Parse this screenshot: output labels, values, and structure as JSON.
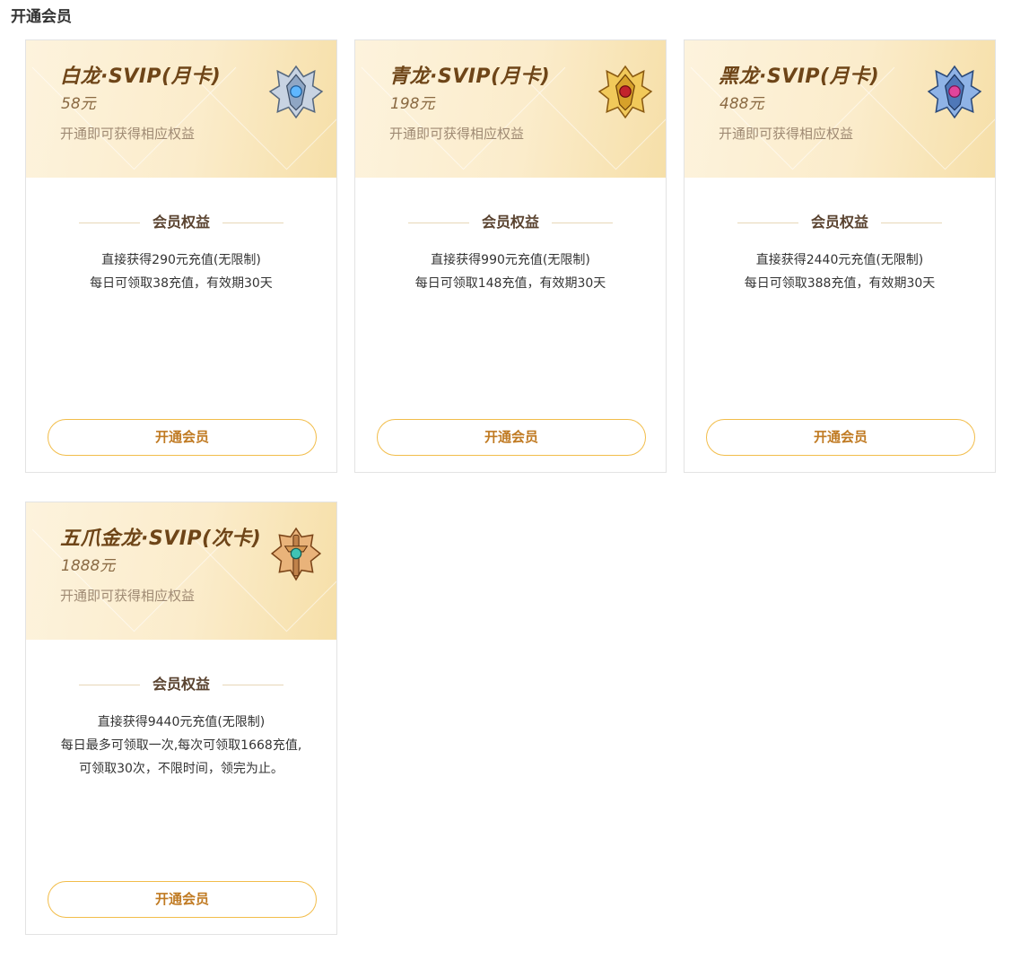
{
  "page": {
    "title": "开通会员"
  },
  "common": {
    "subtitle": "开通即可获得相应权益",
    "benefits_heading": "会员权益",
    "open_button_label": "开通会员"
  },
  "cards": [
    {
      "name": "白龙·SVIP(月卡)",
      "price": "58元",
      "badge_icon": "white-dragon-badge-icon",
      "badge_color": "#8fa6c4",
      "benefits": [
        "直接获得290元充值(无限制)",
        "每日可领取38充值，有效期30天"
      ]
    },
    {
      "name": "青龙·SVIP(月卡)",
      "price": "198元",
      "badge_icon": "azure-dragon-badge-icon",
      "badge_color": "#d6a12a",
      "benefits": [
        "直接获得990元充值(无限制)",
        "每日可领取148充值，有效期30天"
      ]
    },
    {
      "name": "黑龙·SVIP(月卡)",
      "price": "488元",
      "badge_icon": "black-dragon-badge-icon",
      "badge_color": "#4f78b8",
      "benefits": [
        "直接获得2440元充值(无限制)",
        "每日可领取388充值，有效期30天"
      ]
    },
    {
      "name": "五爪金龙·SVIP(次卡)",
      "price": "1888元",
      "badge_icon": "golden-dragon-badge-icon",
      "badge_color": "#c0824a",
      "benefits": [
        "直接获得9440元充值(无限制)",
        "每日最多可领取一次,每次可领取1668充值,",
        "可领取30次，不限时间，领完为止。"
      ]
    }
  ]
}
